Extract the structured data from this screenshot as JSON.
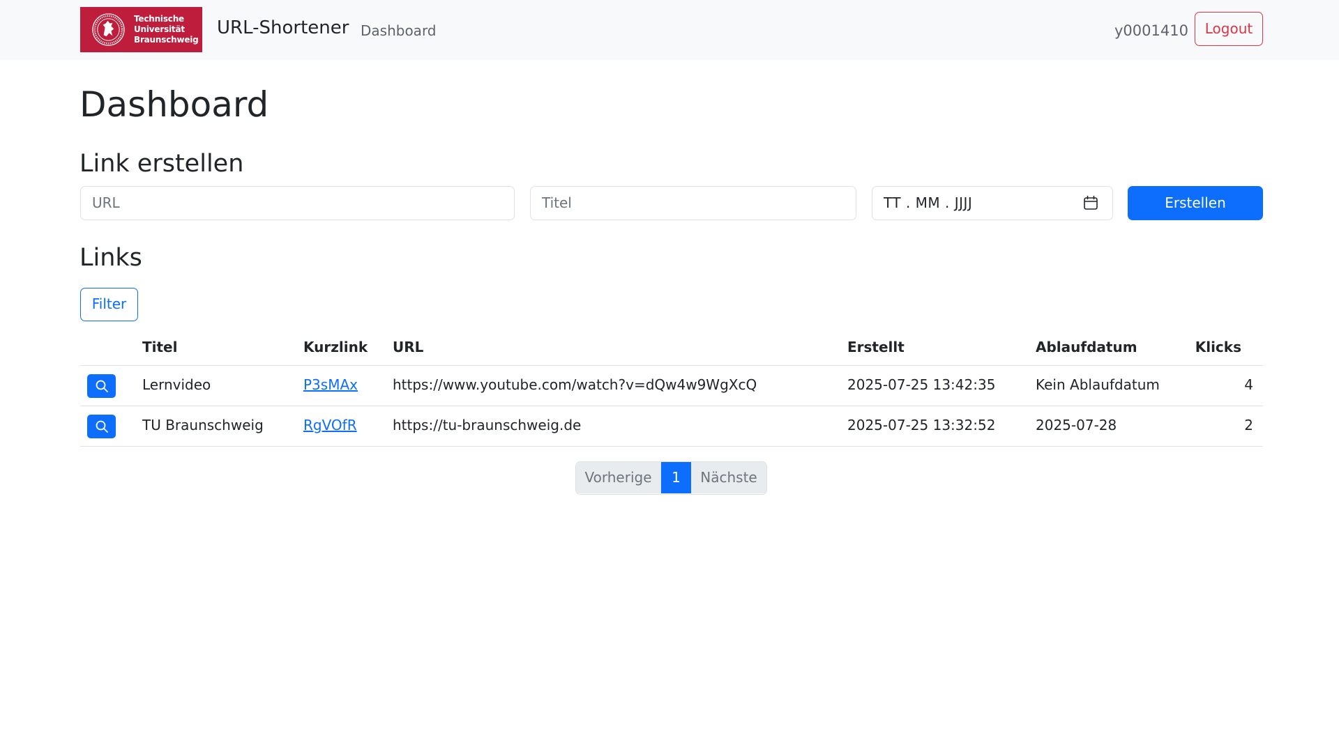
{
  "navbar": {
    "logo_lines": [
      "Technische",
      "Universität",
      "Braunschweig"
    ],
    "brand": "URL-Shortener",
    "nav_dashboard": "Dashboard",
    "user": "y0001410",
    "logout_label": "Logout"
  },
  "page": {
    "title": "Dashboard",
    "create_heading": "Link erstellen",
    "links_heading": "Links"
  },
  "form": {
    "url_placeholder": "URL",
    "title_placeholder": "Titel",
    "date_placeholder": "TT . MM . JJJJ",
    "submit_label": "Erstellen",
    "date_icon": "calendar-icon"
  },
  "filter_label": "Filter",
  "table": {
    "headers": {
      "titel": "Titel",
      "kurzlink": "Kurzlink",
      "url": "URL",
      "erstellt": "Erstellt",
      "ablaufdatum": "Ablaufdatum",
      "klicks": "Klicks"
    },
    "rows": [
      {
        "titel": "Lernvideo",
        "kurzlink": "P3sMAx",
        "url": "https://www.youtube.com/watch?v=dQw4w9WgXcQ",
        "erstellt": "2025-07-25 13:42:35",
        "ablaufdatum": "Kein Ablaufdatum",
        "klicks": "4"
      },
      {
        "titel": "TU Braunschweig",
        "kurzlink": "RgVOfR",
        "url": "https://tu-braunschweig.de",
        "erstellt": "2025-07-25 13:32:52",
        "ablaufdatum": "2025-07-28",
        "klicks": "2"
      }
    ],
    "row_icon": "search-icon"
  },
  "pagination": {
    "prev": "Vorherige",
    "current": "1",
    "next": "Nächste"
  },
  "colors": {
    "primary": "#0d6efd",
    "danger": "#dc3545",
    "brand_red": "#be1e3c",
    "navbar_bg": "#f8f9fa"
  }
}
